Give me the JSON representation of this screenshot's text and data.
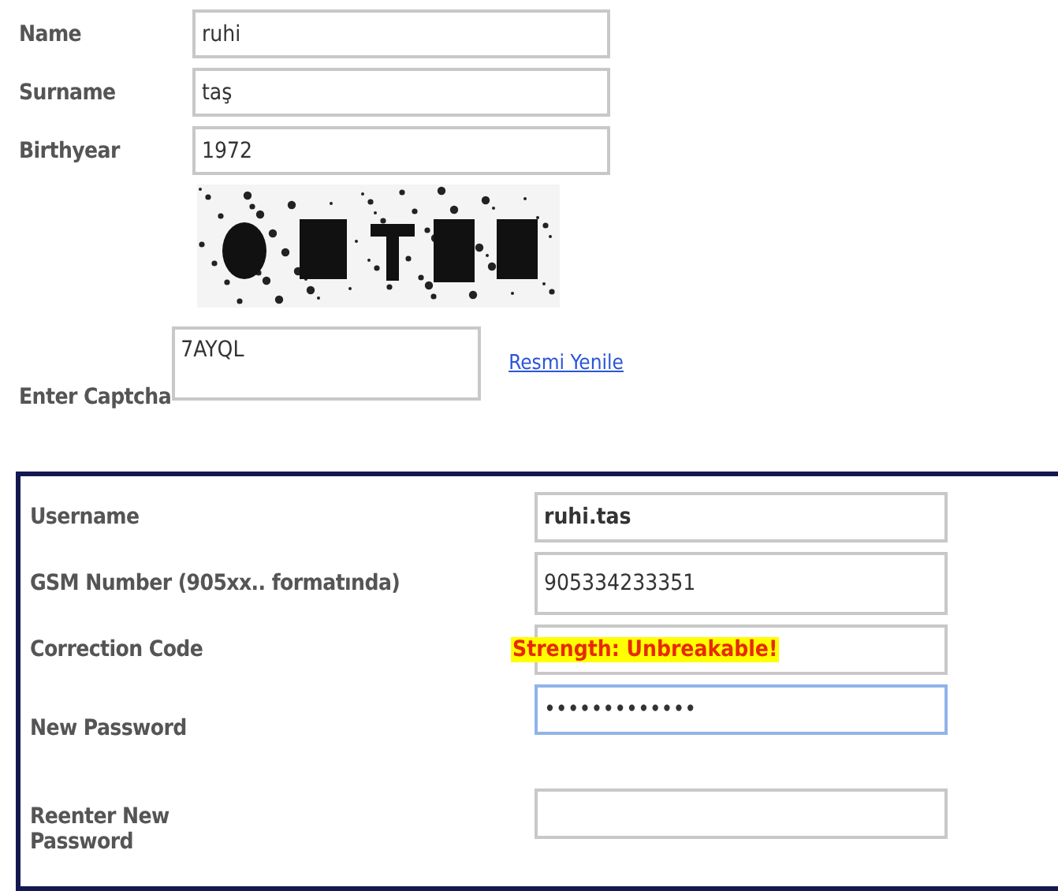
{
  "personal": {
    "fields": [
      {
        "label": "Name",
        "value": "ruhi"
      },
      {
        "label": "Surname",
        "value": "taş"
      },
      {
        "label": "Birthyear",
        "value": "1972"
      }
    ],
    "captcha": {
      "kind": "picture",
      "label": "Enter Captcha",
      "value": "7AYQL",
      "refresh_link": "Resmi Yenile"
    }
  },
  "account": {
    "fields": [
      {
        "label": "Username",
        "value": "ruhi.tas",
        "bold": true,
        "focused": false
      },
      {
        "label": "GSM Number (905xx.. formatında)",
        "value": "905334233351",
        "bold": false,
        "focused": false
      },
      {
        "label": "Correction Code",
        "focused": false,
        "overlay": "Strength: Unbreakable!"
      },
      {
        "label": "New Password",
        "value": "•••••••••••••",
        "bold": false,
        "focused": true
      },
      {
        "label": "Reenter New Password",
        "focused": false
      }
    ]
  }
}
